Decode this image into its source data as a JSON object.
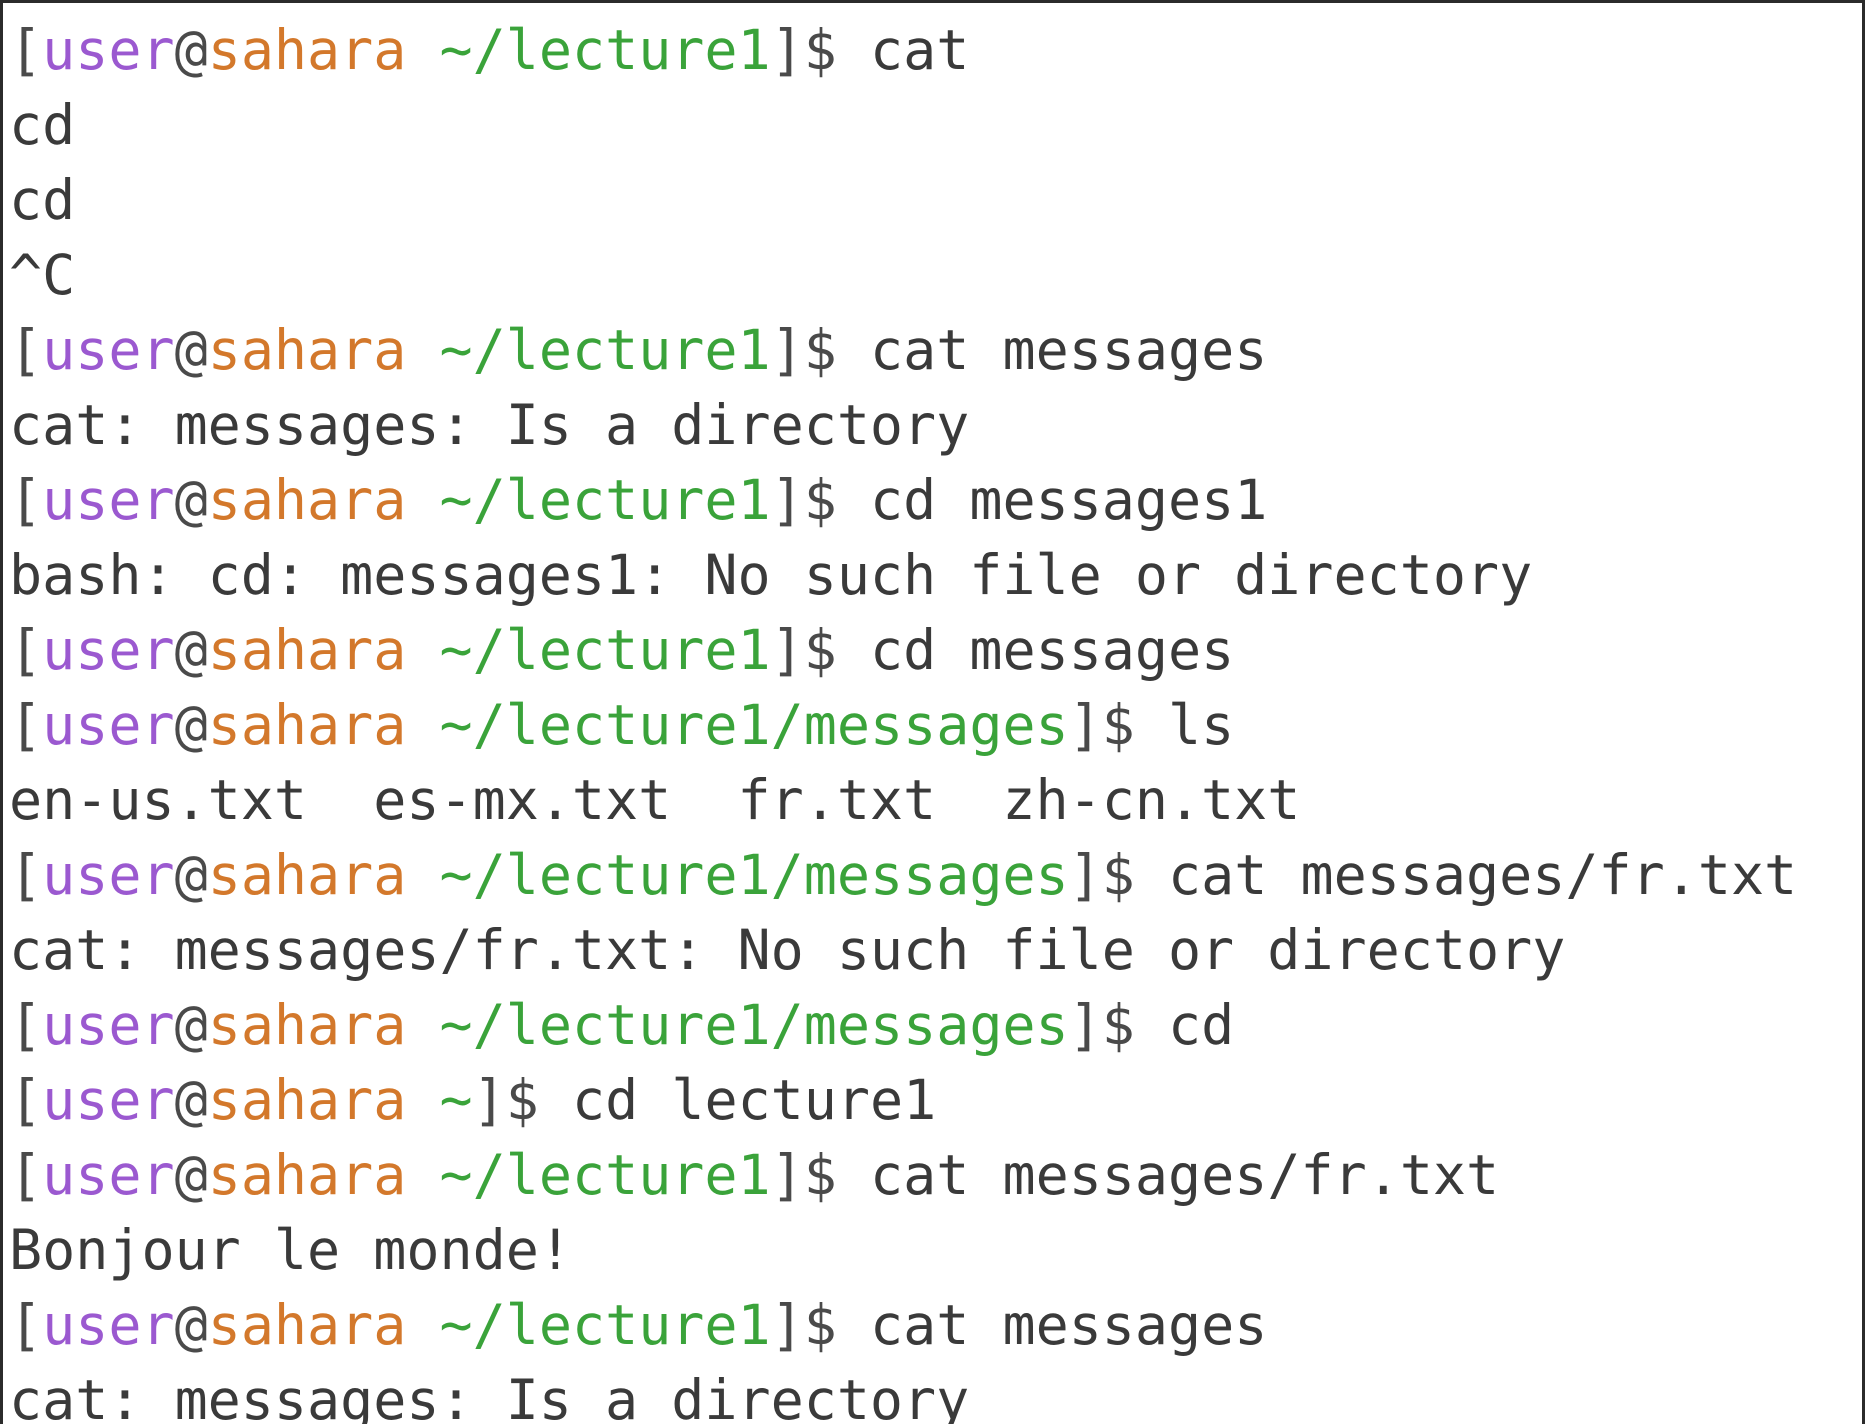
{
  "colors": {
    "background": "#ffffff",
    "text": "#3a3a3a",
    "user": "#9b59d0",
    "host": "#d3782b",
    "path": "#3aa33a"
  },
  "lines": [
    {
      "type": "prompt",
      "user": "user",
      "host": "sahara",
      "path": "~/lecture1",
      "command": "cat"
    },
    {
      "type": "output",
      "text": "cd"
    },
    {
      "type": "output",
      "text": "cd"
    },
    {
      "type": "output",
      "text": "^C"
    },
    {
      "type": "prompt",
      "user": "user",
      "host": "sahara",
      "path": "~/lecture1",
      "command": "cat messages"
    },
    {
      "type": "output",
      "text": "cat: messages: Is a directory"
    },
    {
      "type": "prompt",
      "user": "user",
      "host": "sahara",
      "path": "~/lecture1",
      "command": "cd messages1"
    },
    {
      "type": "output",
      "text": "bash: cd: messages1: No such file or directory"
    },
    {
      "type": "prompt",
      "user": "user",
      "host": "sahara",
      "path": "~/lecture1",
      "command": "cd messages"
    },
    {
      "type": "prompt",
      "user": "user",
      "host": "sahara",
      "path": "~/lecture1/messages",
      "command": "ls"
    },
    {
      "type": "output",
      "text": "en-us.txt  es-mx.txt  fr.txt  zh-cn.txt"
    },
    {
      "type": "prompt",
      "user": "user",
      "host": "sahara",
      "path": "~/lecture1/messages",
      "command": "cat messages/fr.txt"
    },
    {
      "type": "output",
      "text": "cat: messages/fr.txt: No such file or directory"
    },
    {
      "type": "prompt",
      "user": "user",
      "host": "sahara",
      "path": "~/lecture1/messages",
      "command": "cd"
    },
    {
      "type": "prompt",
      "user": "user",
      "host": "sahara",
      "path": "~",
      "command": "cd lecture1"
    },
    {
      "type": "prompt",
      "user": "user",
      "host": "sahara",
      "path": "~/lecture1",
      "command": "cat messages/fr.txt"
    },
    {
      "type": "output",
      "text": "Bonjour le monde!"
    },
    {
      "type": "prompt",
      "user": "user",
      "host": "sahara",
      "path": "~/lecture1",
      "command": "cat messages"
    },
    {
      "type": "output",
      "text": "cat: messages: Is a directory"
    }
  ]
}
